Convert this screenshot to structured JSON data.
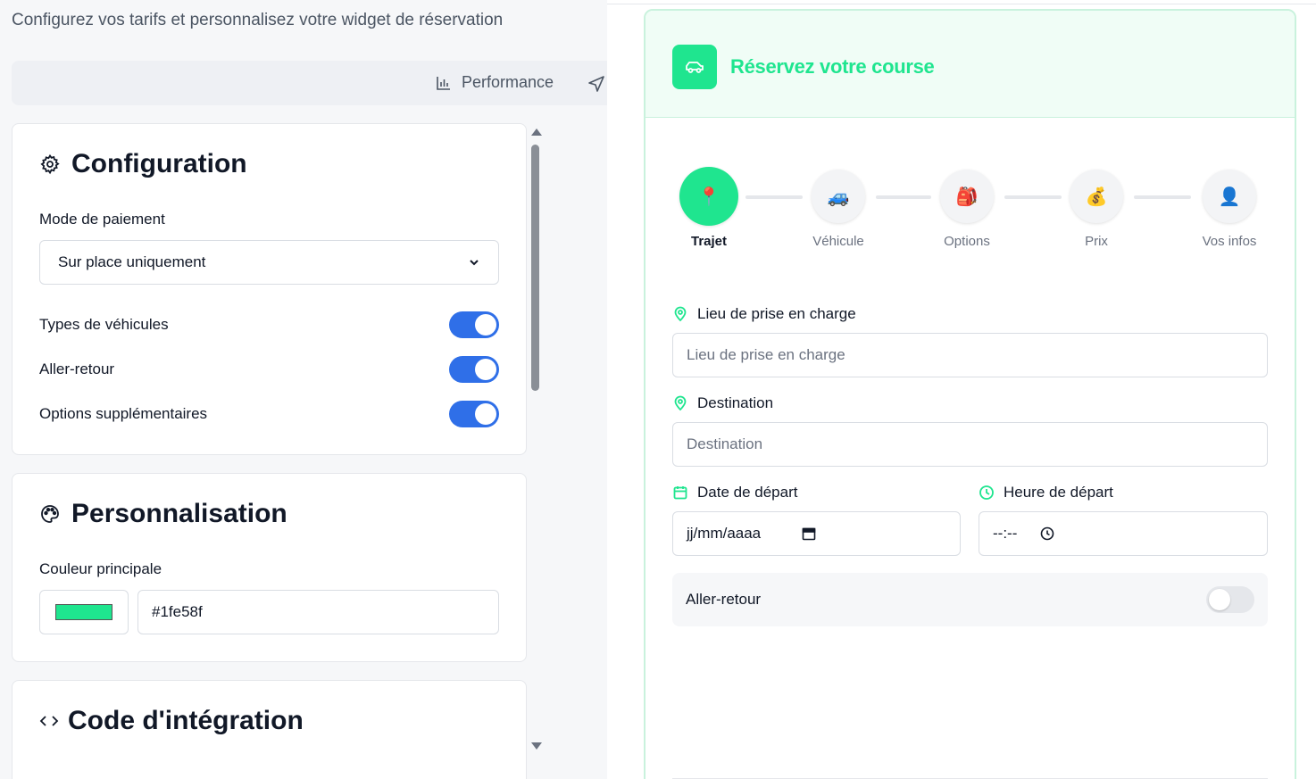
{
  "header": {
    "subtitle": "Configurez vos tarifs et personnalisez votre widget de réservation"
  },
  "tabs": {
    "performance": "Performance"
  },
  "configuration": {
    "title": "Configuration",
    "payment_label": "Mode de paiement",
    "payment_value": "Sur place uniquement",
    "toggles": [
      {
        "label": "Types de véhicules",
        "on": true
      },
      {
        "label": "Aller-retour",
        "on": true
      },
      {
        "label": "Options supplémentaires",
        "on": true
      }
    ]
  },
  "personalisation": {
    "title": "Personnalisation",
    "color_label": "Couleur principale",
    "color_value": "#1fe58f"
  },
  "integration": {
    "title": "Code d'intégration"
  },
  "widget": {
    "title": "Réservez votre course",
    "accent": "#1fe58f",
    "steps": [
      {
        "label": "Trajet",
        "icon": "📍",
        "active": true
      },
      {
        "label": "Véhicule",
        "icon": "🚙",
        "active": false
      },
      {
        "label": "Options",
        "icon": "🎒",
        "active": false
      },
      {
        "label": "Prix",
        "icon": "💰",
        "active": false
      },
      {
        "label": "Vos infos",
        "icon": "👤",
        "active": false
      }
    ],
    "pickup_label": "Lieu de prise en charge",
    "pickup_placeholder": "Lieu de prise en charge",
    "destination_label": "Destination",
    "destination_placeholder": "Destination",
    "date_label": "Date de départ",
    "date_value": "jj/mm/aaaa",
    "time_label": "Heure de départ",
    "time_value": "--:--",
    "roundtrip_label": "Aller-retour",
    "roundtrip_on": false
  }
}
